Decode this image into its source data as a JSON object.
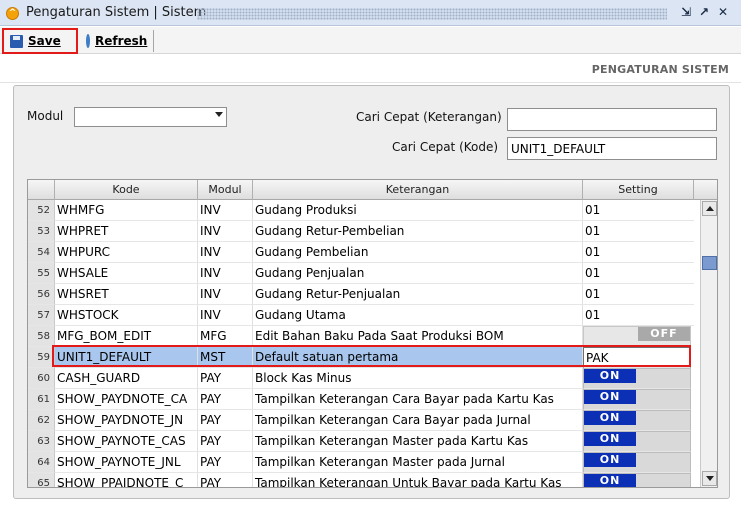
{
  "window": {
    "title": "Pengaturan Sistem | Sistem",
    "app_icon": "app-logo-icon",
    "controls": [
      "restore-icon",
      "popout-icon",
      "close-icon"
    ]
  },
  "toolbar": {
    "save_label": "Save",
    "refresh_label": "Refresh"
  },
  "page": {
    "title": "PENGATURAN SISTEM"
  },
  "filters": {
    "modul_label": "Modul",
    "modul_value": "",
    "cari_keterangan_label": "Cari Cepat (Keterangan)",
    "cari_keterangan_value": "",
    "cari_kode_label": "Cari Cepat (Kode)",
    "cari_kode_value": "UNIT1_DEFAULT"
  },
  "grid": {
    "columns": [
      "Kode",
      "Modul",
      "Keterangan",
      "Setting"
    ],
    "rows": [
      {
        "no": "52",
        "kode": "WHMFG",
        "modul": "INV",
        "keterangan": "Gudang Produksi",
        "setting": "01",
        "type": "text"
      },
      {
        "no": "53",
        "kode": "WHPRET",
        "modul": "INV",
        "keterangan": "Gudang Retur-Pembelian",
        "setting": "01",
        "type": "text"
      },
      {
        "no": "54",
        "kode": "WHPURC",
        "modul": "INV",
        "keterangan": "Gudang Pembelian",
        "setting": "01",
        "type": "text"
      },
      {
        "no": "55",
        "kode": "WHSALE",
        "modul": "INV",
        "keterangan": "Gudang Penjualan",
        "setting": "01",
        "type": "text"
      },
      {
        "no": "56",
        "kode": "WHSRET",
        "modul": "INV",
        "keterangan": "Gudang Retur-Penjualan",
        "setting": "01",
        "type": "text"
      },
      {
        "no": "57",
        "kode": "WHSTOCK",
        "modul": "INV",
        "keterangan": "Gudang Utama",
        "setting": "01",
        "type": "text"
      },
      {
        "no": "58",
        "kode": "MFG_BOM_EDIT",
        "modul": "MFG",
        "keterangan": "Edit Bahan Baku Pada Saat Produksi BOM",
        "setting": "OFF",
        "type": "toggle-off"
      },
      {
        "no": "59",
        "kode": "UNIT1_DEFAULT",
        "modul": "MST",
        "keterangan": "Default satuan pertama",
        "setting": "PAK",
        "type": "edit"
      },
      {
        "no": "60",
        "kode": "CASH_GUARD",
        "modul": "PAY",
        "keterangan": "Block Kas Minus",
        "setting": "ON",
        "type": "toggle-on"
      },
      {
        "no": "61",
        "kode": "SHOW_PAYDNOTE_CA",
        "modul": "PAY",
        "keterangan": "Tampilkan Keterangan Cara Bayar pada Kartu Kas",
        "setting": "ON",
        "type": "toggle-on"
      },
      {
        "no": "62",
        "kode": "SHOW_PAYDNOTE_JN",
        "modul": "PAY",
        "keterangan": "Tampilkan Keterangan Cara Bayar pada Jurnal",
        "setting": "ON",
        "type": "toggle-on"
      },
      {
        "no": "63",
        "kode": "SHOW_PAYNOTE_CAS",
        "modul": "PAY",
        "keterangan": "Tampilkan Keterangan Master pada Kartu Kas",
        "setting": "ON",
        "type": "toggle-on"
      },
      {
        "no": "64",
        "kode": "SHOW_PAYNOTE_JNL",
        "modul": "PAY",
        "keterangan": "Tampilkan Keterangan Master pada Jurnal",
        "setting": "ON",
        "type": "toggle-on"
      },
      {
        "no": "65",
        "kode": "SHOW_PPAIDNOTE_C",
        "modul": "PAY",
        "keterangan": "Tampilkan Keterangan Untuk Bayar pada Kartu Kas",
        "setting": "ON",
        "type": "toggle-on"
      }
    ],
    "selected_row": "59"
  },
  "colors": {
    "accent_red": "#e21a1a",
    "toggle_on": "#0b2fb5",
    "toggle_off": "#a9a9a9",
    "selection": "#a9c7ee"
  }
}
